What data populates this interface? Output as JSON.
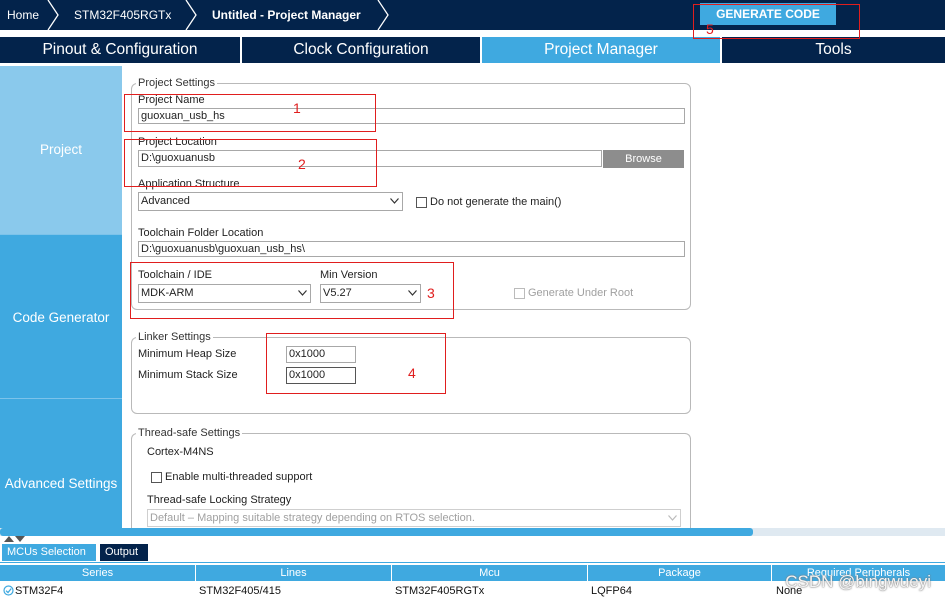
{
  "breadcrumb": {
    "home": "Home",
    "chip": "STM32F405RGTx",
    "project": "Untitled - Project Manager"
  },
  "generate_code": "GENERATE CODE",
  "tabs": [
    {
      "label": "Pinout & Configuration"
    },
    {
      "label": "Clock Configuration"
    },
    {
      "label": "Project Manager",
      "active": true
    },
    {
      "label": "Tools"
    }
  ],
  "nav": {
    "project": "Project",
    "code_generator": "Code Generator",
    "advanced": "Advanced Settings"
  },
  "project_settings": {
    "title": "Project Settings",
    "name_label": "Project Name",
    "name_value": "guoxuan_usb_hs",
    "location_label": "Project Location",
    "location_value": "D:\\guoxuanusb",
    "browse": "Browse",
    "app_structure_label": "Application Structure",
    "app_structure_value": "Advanced",
    "no_main_label": "Do not generate the main()",
    "toolchain_folder_label": "Toolchain Folder Location",
    "toolchain_folder_value": "D:\\guoxuanusb\\guoxuan_usb_hs\\",
    "toolchain_label": "Toolchain / IDE",
    "toolchain_value": "MDK-ARM",
    "min_version_label": "Min Version",
    "min_version_value": "V5.27",
    "under_root_label": "Generate Under Root"
  },
  "linker": {
    "title": "Linker Settings",
    "heap_label": "Minimum Heap Size",
    "heap_value": "0x1000",
    "stack_label": "Minimum Stack Size",
    "stack_value": "0x1000"
  },
  "thread_safe": {
    "title": "Thread-safe Settings",
    "core": "Cortex-M4NS",
    "multi_thread_label": "Enable multi-threaded support",
    "locking_label": "Thread-safe Locking Strategy",
    "locking_value": "Default  –  Mapping suitable strategy depending on RTOS selection."
  },
  "annotations": [
    "1",
    "2",
    "3",
    "4",
    "5"
  ],
  "colors": {
    "navy": "#03234b",
    "accent": "#3fa9e0",
    "annotation_red": "#e01e1e"
  },
  "bottom_tabs": [
    "MCUs Selection",
    "Output"
  ],
  "table": {
    "headers": [
      "Series",
      "Lines",
      "Mcu",
      "Package",
      "Required Peripherals"
    ],
    "row": [
      "STM32F4",
      "STM32F405/415",
      "STM32F405RGTx",
      "LQFP64",
      "None"
    ]
  },
  "watermark": "CSDN @bingwueyi"
}
